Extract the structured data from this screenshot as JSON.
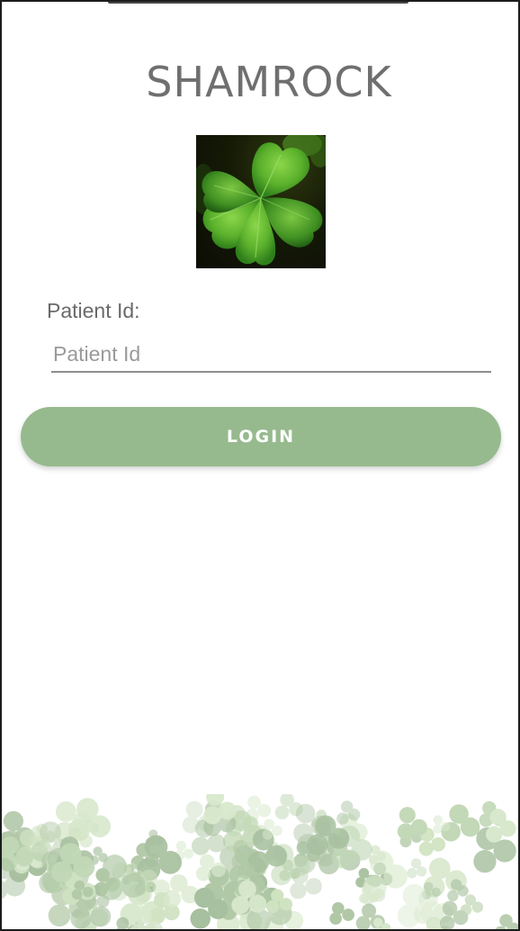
{
  "app": {
    "title": "SHAMROCK"
  },
  "form": {
    "patient_label": "Patient Id:",
    "patient_placeholder": "Patient Id",
    "patient_value": "",
    "login_label": "LOGIN"
  },
  "icons": {
    "logo": "shamrock-leaf-icon",
    "footer": "clover-border-decoration"
  },
  "colors": {
    "button": "#96ba8e",
    "title": "#6f6f6f",
    "leaf": "#5fae2e",
    "footer_clover": "#7fa86a"
  }
}
